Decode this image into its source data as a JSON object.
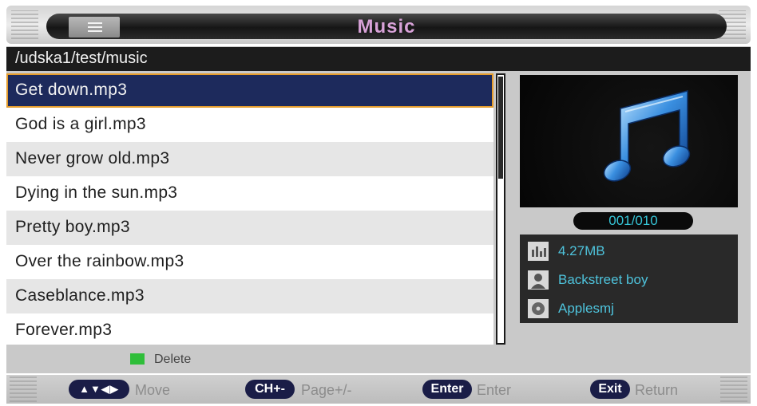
{
  "header": {
    "title": "Music",
    "menu_icon": "list-icon"
  },
  "path": "/udska1/test/music",
  "files": [
    {
      "name": "Get down.mp3",
      "selected": true
    },
    {
      "name": "God is a girl.mp3"
    },
    {
      "name": "Never grow old.mp3"
    },
    {
      "name": "Dying in the sun.mp3"
    },
    {
      "name": "Pretty boy.mp3"
    },
    {
      "name": "Over the rainbow.mp3"
    },
    {
      "name": "Caseblance.mp3"
    },
    {
      "name": "Forever.mp3"
    }
  ],
  "color_key": {
    "label": "Delete",
    "color": "#2fbe3a"
  },
  "counter": "001/010",
  "info": {
    "size": "4.27MB",
    "artist": "Backstreet boy",
    "album": "Applesmj"
  },
  "footer": {
    "move_key": "▲▼◀▶",
    "move_label": "Move",
    "page_key": "CH+-",
    "page_label": "Page+/-",
    "enter_key": "Enter",
    "enter_label": "Enter",
    "exit_key": "Exit",
    "exit_label": "Return"
  },
  "colors": {
    "selection": "#1d2a5c",
    "selection_border": "#e59c2c",
    "accent_text": "#4ec3dc",
    "title_text": "#d8a2d8"
  }
}
